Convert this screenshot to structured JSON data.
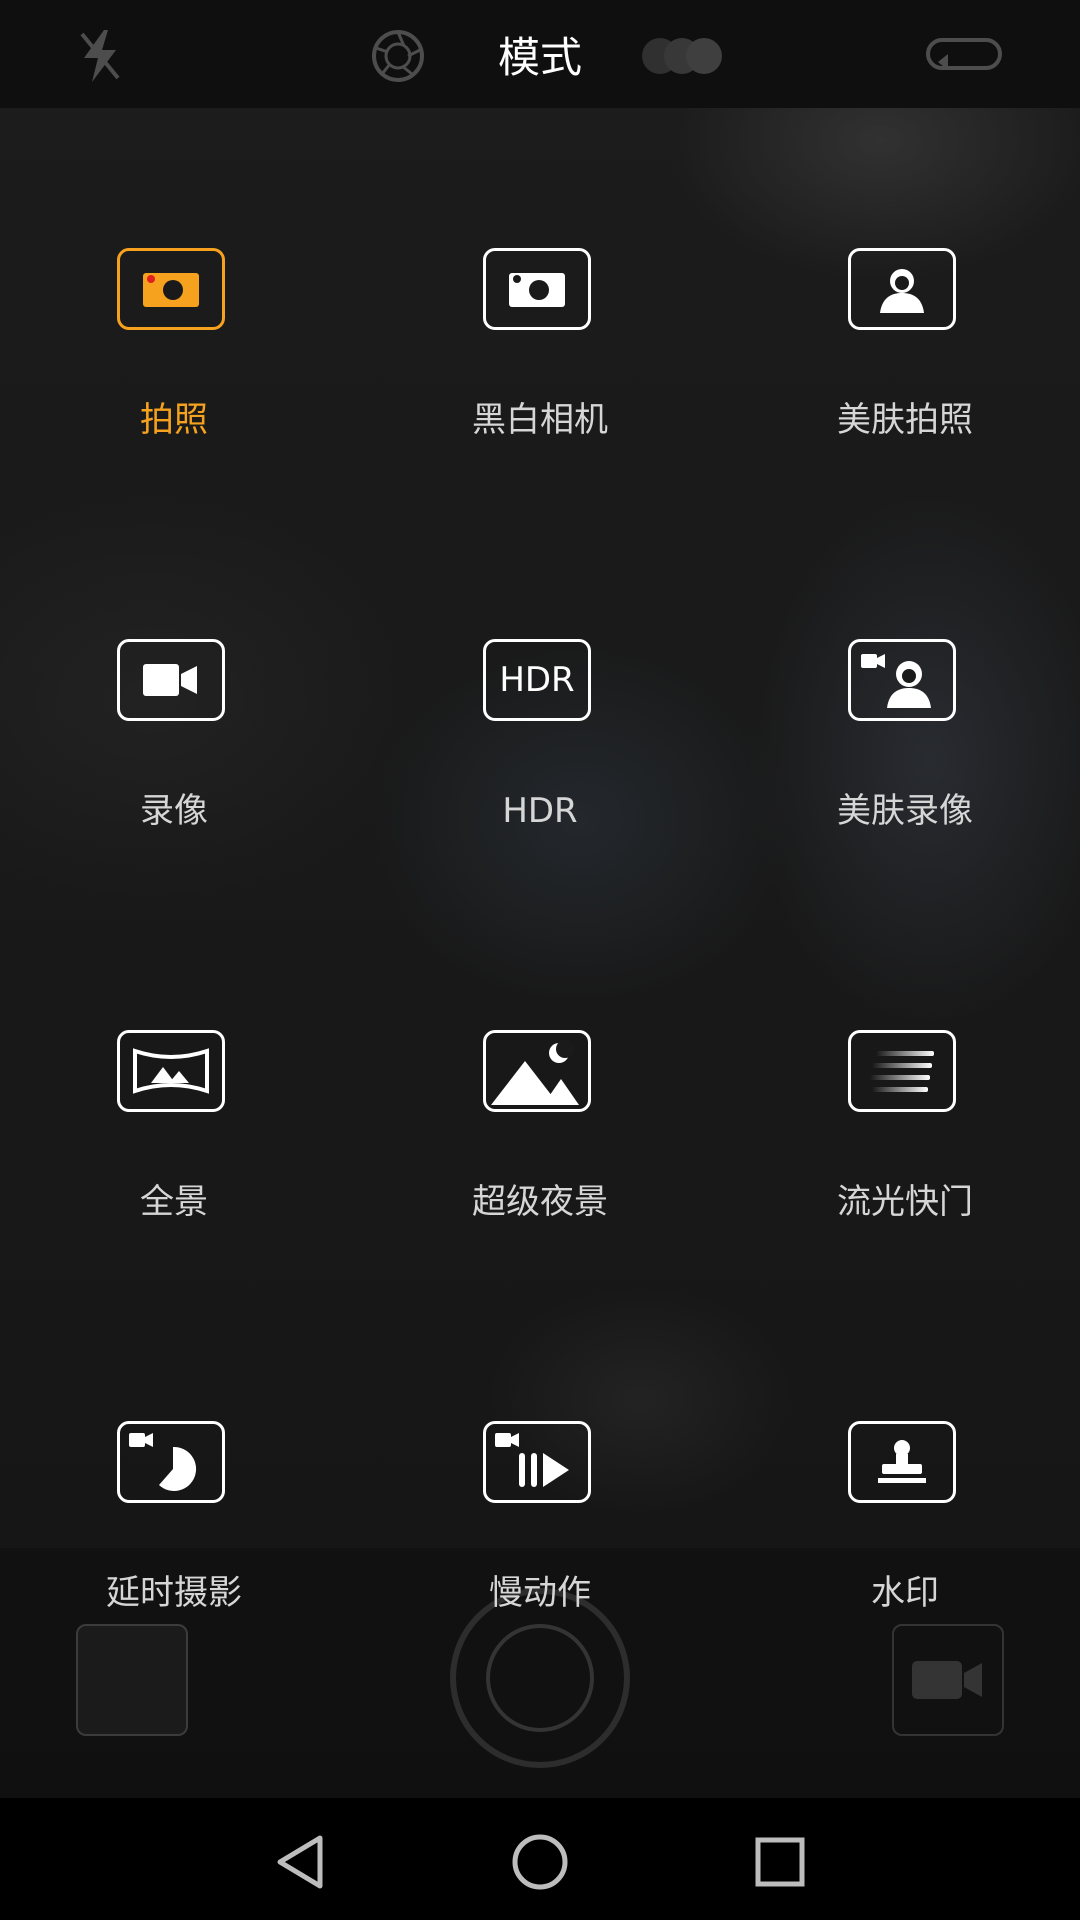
{
  "header": {
    "title": "模式",
    "icons": [
      "flash-off-icon",
      "aperture-icon",
      "color-filter-icon",
      "switch-camera-icon"
    ]
  },
  "modes": [
    {
      "label": "拍照",
      "icon": "camera-icon",
      "active": true
    },
    {
      "label": "黑白相机",
      "icon": "monochrome-camera-icon",
      "active": false
    },
    {
      "label": "美肤拍照",
      "icon": "beauty-portrait-icon",
      "active": false
    },
    {
      "label": "录像",
      "icon": "video-camera-icon",
      "active": false
    },
    {
      "label": "HDR",
      "icon": "hdr-icon",
      "active": false
    },
    {
      "label": "美肤录像",
      "icon": "beauty-video-icon",
      "active": false
    },
    {
      "label": "全景",
      "icon": "panorama-icon",
      "active": false
    },
    {
      "label": "超级夜景",
      "icon": "night-scene-icon",
      "active": false
    },
    {
      "label": "流光快门",
      "icon": "light-painting-icon",
      "active": false
    },
    {
      "label": "延时摄影",
      "icon": "time-lapse-icon",
      "active": false
    },
    {
      "label": "慢动作",
      "icon": "slow-motion-icon",
      "active": false
    },
    {
      "label": "水印",
      "icon": "watermark-icon",
      "active": false
    }
  ],
  "hdr_icon_text": "HDR",
  "colors": {
    "accent": "#f6a21e",
    "tile_border": "#ffffff",
    "label": "#d6d6d6",
    "title": "#ffffff"
  },
  "navbar": [
    "back-icon",
    "home-icon",
    "recents-icon"
  ]
}
